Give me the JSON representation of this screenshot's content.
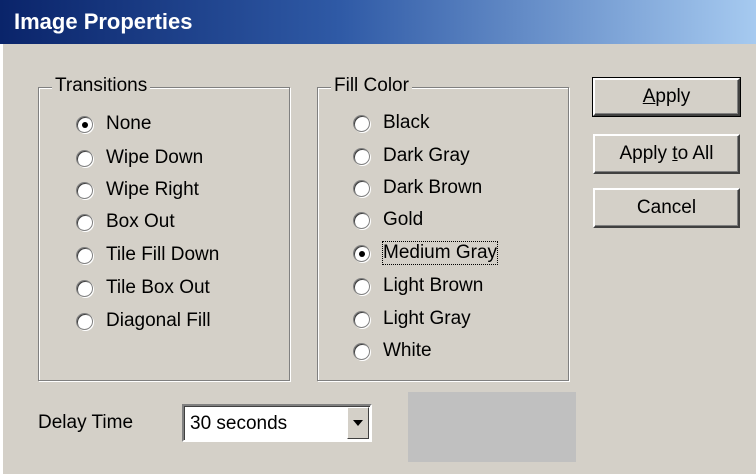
{
  "window": {
    "title": "Image Properties"
  },
  "transitions": {
    "legend": "Transitions",
    "selected": "None",
    "options": [
      "None",
      "Wipe Down",
      "Wipe Right",
      "Box Out",
      "Tile Fill Down",
      "Tile Box Out",
      "Diagonal Fill"
    ]
  },
  "fill_color": {
    "legend": "Fill Color",
    "selected": "Medium Gray",
    "options": [
      "Black",
      "Dark Gray",
      "Dark Brown",
      "Gold",
      "Medium Gray",
      "Light Brown",
      "Light Gray",
      "White"
    ]
  },
  "buttons": {
    "apply": {
      "accel": "A",
      "rest": "pply"
    },
    "apply_to_all": {
      "pre": "Apply ",
      "accel": "t",
      "post": "o All"
    },
    "cancel": "Cancel"
  },
  "delay": {
    "label": "Delay Time",
    "value": "30 seconds"
  },
  "preview": {
    "color": "#c0c0c0"
  },
  "colors": {
    "dialog_bg": "#d4d0c8",
    "title_start": "#0a246a",
    "title_end": "#a6caf0"
  }
}
